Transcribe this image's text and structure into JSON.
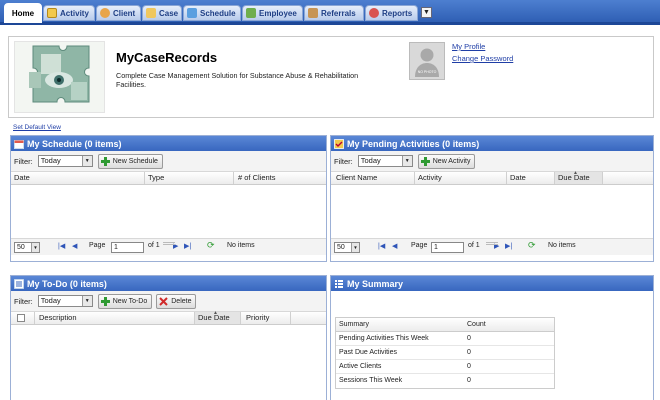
{
  "tabs": [
    {
      "label": "Home",
      "icon": "home-icon"
    },
    {
      "label": "Activity",
      "icon": "checklist-icon"
    },
    {
      "label": "Client",
      "icon": "client-icon"
    },
    {
      "label": "Case",
      "icon": "folder-icon"
    },
    {
      "label": "Schedule",
      "icon": "calendar-icon"
    },
    {
      "label": "Employee",
      "icon": "employee-icon"
    },
    {
      "label": "Referrals",
      "icon": "referral-icon"
    },
    {
      "label": "Reports",
      "icon": "reports-icon"
    }
  ],
  "header": {
    "title": "MyCaseRecords",
    "description": "Complete Case Management Solution for Substance Abuse & Rehabilitation Facilities.",
    "avatar_caption": "NO PHOTO",
    "my_profile": "My Profile",
    "change_password": "Change Password"
  },
  "set_default_view": "Set Default View",
  "schedule": {
    "title": "My Schedule (0 items)",
    "filter_label": "Filter:",
    "filter_value": "Today",
    "new_button": "New Schedule",
    "columns": [
      "Date",
      "Type",
      "# of Clients"
    ],
    "pager": {
      "page_size": "50",
      "page_label": "Page",
      "page_value": "1",
      "of_label": "of 1",
      "status": "No items"
    }
  },
  "pending": {
    "title": "My Pending Activities (0 items)",
    "filter_label": "Filter:",
    "filter_value": "Today",
    "new_button": "New Activity",
    "columns": [
      "Client Name",
      "Activity",
      "Date",
      "Due Date"
    ],
    "pager": {
      "page_size": "50",
      "page_label": "Page",
      "page_value": "1",
      "of_label": "of 1",
      "status": "No items"
    }
  },
  "todo": {
    "title": "My To-Do (0 items)",
    "filter_label": "Filter:",
    "filter_value": "Today",
    "new_button": "New To-Do",
    "delete_button": "Delete",
    "columns": [
      "Description",
      "Due Date",
      "Priority"
    ]
  },
  "summary": {
    "title": "My Summary",
    "col_summary": "Summary",
    "col_count": "Count",
    "rows": [
      {
        "label": "Pending Activities This Week",
        "count": "0"
      },
      {
        "label": "Past Due Activities",
        "count": "0"
      },
      {
        "label": "Active Clients",
        "count": "0"
      },
      {
        "label": "Sessions This Week",
        "count": "0"
      }
    ]
  },
  "colors": {
    "header_blue": "#3867bf",
    "link": "#1f3ea6",
    "add_green": "#2e9a32",
    "delete_red": "#d02a2a"
  }
}
